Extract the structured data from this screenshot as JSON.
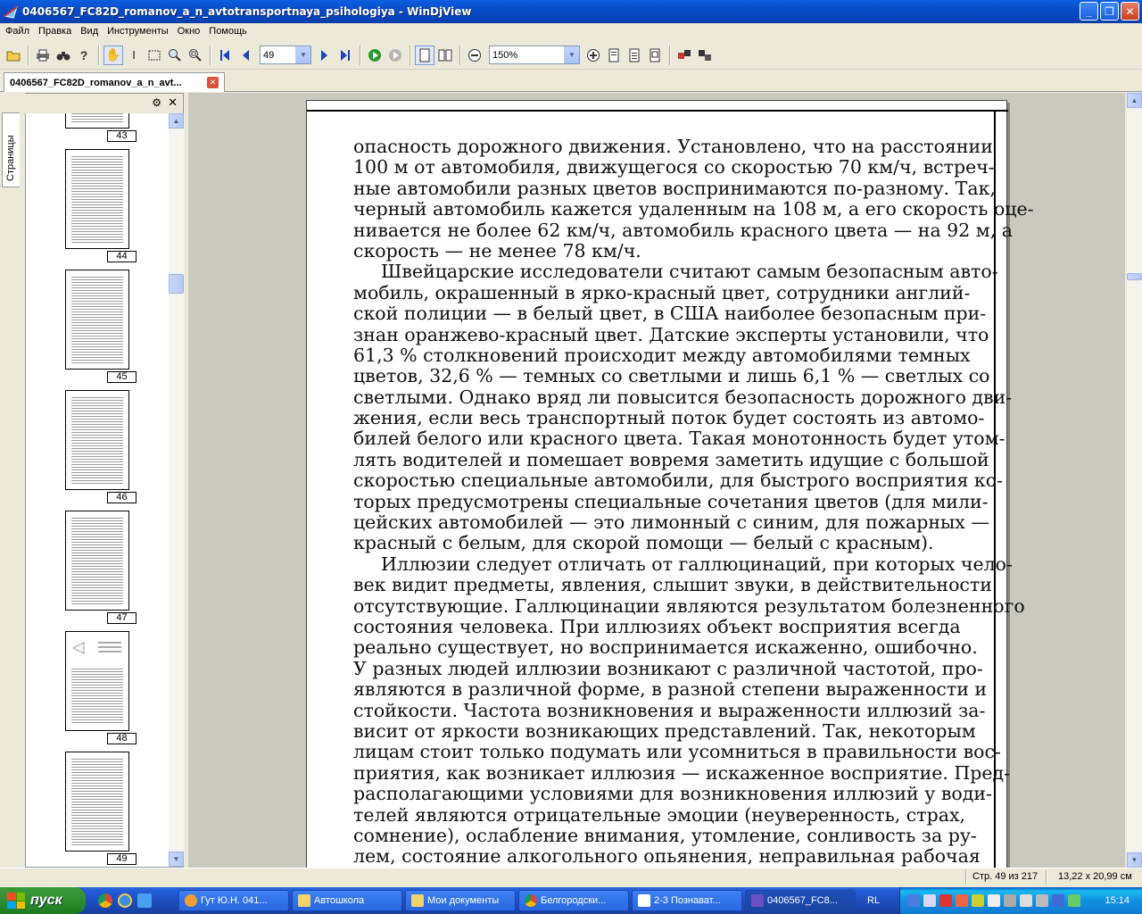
{
  "window": {
    "title": "0406567_FC82D_romanov_a_n_avtotransportnaya_psihologiya - WinDjView",
    "buttons": [
      "minimize",
      "maximize",
      "close"
    ]
  },
  "menu": [
    "Файл",
    "Правка",
    "Вид",
    "Инструменты",
    "Окно",
    "Помощь"
  ],
  "toolbar": {
    "page_value": "49",
    "zoom_value": "150%"
  },
  "doc_tab": {
    "label": "0406567_FC82D_romanov_a_n_avt..."
  },
  "side_panel": {
    "tab_label": "Страницы",
    "thumbnails": [
      "43",
      "44",
      "45",
      "46",
      "47",
      "48",
      "49"
    ]
  },
  "page_text": [
    {
      "t": "опасность дорожного движения. Установлено, что на расстоянии",
      "cls": ""
    },
    {
      "t": "100 м от автомобиля, движущегося со скоростью 70 км/ч, встреч-",
      "cls": ""
    },
    {
      "t": "ные автомобили разных цветов воспринимаются по-разному. Так,",
      "cls": ""
    },
    {
      "t": "черный автомобиль кажется удаленным на 108 м, а его скорость оце-",
      "cls": ""
    },
    {
      "t": "нивается не более 62 км/ч, автомобиль красного цвета — на 92 м, а",
      "cls": ""
    },
    {
      "t": "скорость — не менее 78 км/ч.",
      "cls": "last"
    },
    {
      "t": "Швейцарские исследователи считают самым безопасным авто-",
      "cls": "indent"
    },
    {
      "t": "мобиль, окрашенный в ярко-красный цвет, сотрудники англий-",
      "cls": ""
    },
    {
      "t": "ской полиции — в белый цвет, в США наиболее безопасным при-",
      "cls": ""
    },
    {
      "t": "знан оранжево-красный цвет. Датские эксперты установили, что",
      "cls": ""
    },
    {
      "t": "61,3 % столкновений происходит между автомобилями темных",
      "cls": ""
    },
    {
      "t": "цветов, 32,6 % — темных со светлыми и лишь 6,1 % — светлых со",
      "cls": ""
    },
    {
      "t": "светлыми. Однако вряд ли повысится безопасность дорожного дви-",
      "cls": ""
    },
    {
      "t": "жения, если весь транспортный поток будет состоять из автомо-",
      "cls": ""
    },
    {
      "t": "билей белого или красного цвета. Такая монотонность будет утом-",
      "cls": ""
    },
    {
      "t": "лять водителей и помешает вовремя заметить идущие с большой",
      "cls": ""
    },
    {
      "t": "скоростью специальные автомобили, для быстрого восприятия ко-",
      "cls": ""
    },
    {
      "t": "торых предусмотрены специальные сочетания цветов (для мили-",
      "cls": ""
    },
    {
      "t": "цейских автомобилей — это лимонный с синим, для пожарных —",
      "cls": ""
    },
    {
      "t": "красный с белым, для скорой помощи — белый с красным).",
      "cls": "last"
    },
    {
      "t": "Иллюзии следует отличать от галлюцинаций, при которых чело-",
      "cls": "indent"
    },
    {
      "t": "век видит предметы, явления, слышит звуки, в действительности",
      "cls": ""
    },
    {
      "t": "отсутствующие. Галлюцинации являются результатом болезненного",
      "cls": ""
    },
    {
      "t": "состояния человека. При иллюзиях объект восприятия всегда",
      "cls": ""
    },
    {
      "t": "реально существует, но воспринимается искаженно, ошибочно.",
      "cls": ""
    },
    {
      "t": "У разных людей иллюзии возникают с различной частотой, про-",
      "cls": ""
    },
    {
      "t": "являются в различной форме, в разной степени выраженности и",
      "cls": ""
    },
    {
      "t": "стойкости. Частота возникновения и выраженности иллюзий за-",
      "cls": ""
    },
    {
      "t": "висит от яркости возникающих представлений. Так, некоторым",
      "cls": ""
    },
    {
      "t": "лицам стоит только подумать или усомниться в правильности вос-",
      "cls": ""
    },
    {
      "t": "приятия, как возникает иллюзия — искаженное восприятие. Пред-",
      "cls": ""
    },
    {
      "t": "располагающими условиями для возникновения иллюзий у води-",
      "cls": ""
    },
    {
      "t": "телей являются отрицательные эмоции (неуверенность, страх,",
      "cls": ""
    },
    {
      "t": "сомнение), ослабление внимания, утомление, сонливость за ру-",
      "cls": ""
    },
    {
      "t": "лем, состояние алкогольного опьянения, неправильная рабочая",
      "cls": ""
    }
  ],
  "status": {
    "page": "Стр. 49 из 217",
    "size": "13,22 x 20,99 см"
  },
  "taskbar": {
    "start_label": "пуск",
    "tasks": [
      {
        "label": "Гут Ю.Н. 041...",
        "color": "#f0a030"
      },
      {
        "label": "Автошкола",
        "color": "#f2d36b"
      },
      {
        "label": "Мои документы",
        "color": "#f2d36b"
      },
      {
        "label": "Белгородски...",
        "color": "#e04a3a"
      },
      {
        "label": "2-3 Познават...",
        "color": "#ffffff"
      },
      {
        "label": "0406567_FC8...",
        "color": "#6a4fc0"
      }
    ],
    "lang": "RL",
    "clock": "15:14"
  }
}
